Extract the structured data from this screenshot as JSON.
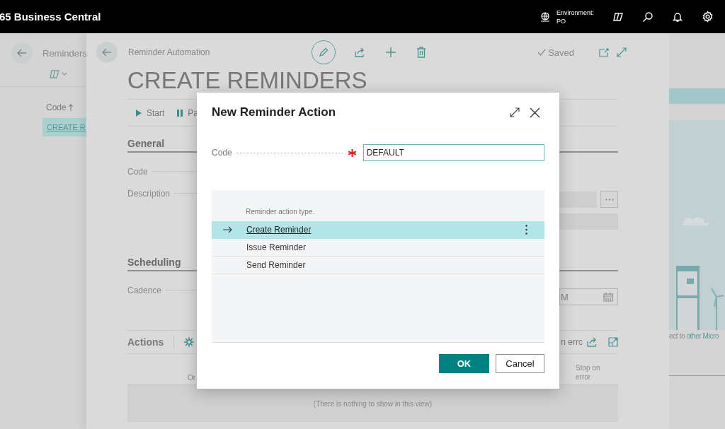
{
  "top_bar": {
    "app_name": "65 Business Central",
    "environment_label": "Environment:",
    "environment_value": "PO"
  },
  "background_list": {
    "title": "Reminders",
    "column": "Code",
    "rows": [
      {
        "code": "CREATE R",
        "selected": true
      }
    ]
  },
  "background_promo": {
    "text": "ect to ",
    "link": "other Micro"
  },
  "card": {
    "breadcrumb": "Reminder Automation",
    "status": "Saved",
    "title": "CREATE REMINDERS",
    "actions": [
      {
        "label": "Start"
      },
      {
        "label": "Pa"
      }
    ],
    "general": {
      "header": "General",
      "fields": [
        {
          "label": "Code"
        },
        {
          "label": "Description"
        }
      ]
    },
    "scheduling": {
      "header": "Scheduling",
      "fields": [
        {
          "label": "Cadence",
          "value": "M"
        }
      ]
    },
    "lines": {
      "header": "Actions",
      "partial_action": "n errc",
      "columns": [
        "Or",
        "Stop on error"
      ],
      "empty_text": "(There is nothing to show in this view)"
    }
  },
  "dialog": {
    "title": "New Reminder Action",
    "code_label": "Code",
    "required": true,
    "code_value": "DEFAULT",
    "list_header": "Reminder action type.",
    "options": [
      {
        "label": "Create Reminder",
        "selected": true
      },
      {
        "label": "Issue Reminder",
        "selected": false
      },
      {
        "label": "Send Reminder",
        "selected": false
      }
    ],
    "buttons": [
      {
        "label": "OK",
        "kind": "primary"
      },
      {
        "label": "Cancel",
        "kind": "secondary"
      }
    ]
  }
}
